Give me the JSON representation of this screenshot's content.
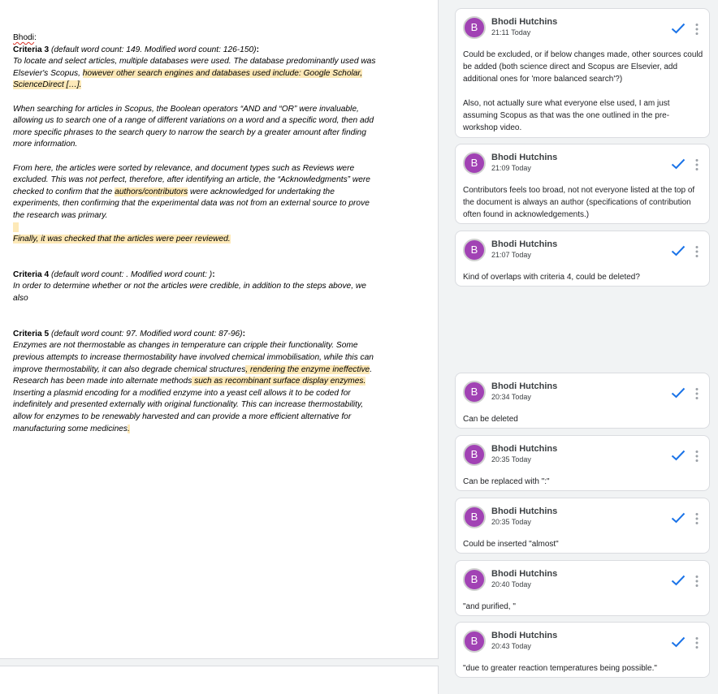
{
  "document": {
    "greeting": "Bhodi",
    "greeting_colon": ":",
    "criteria3": {
      "heading": "Criteria 3",
      "note": " (default word count: 149. Modified word count: 126-150)",
      "colon": ":",
      "p1_a": "To locate and select articles, multiple databases were used. The database predominantly used was Elsevier's Scopus, ",
      "p1_hl": "however other search engines and databases used include: Google Scholar, ScienceDirect […].",
      "p2": "When searching for articles in Scopus, the Boolean operators “AND and “OR” were invaluable, allowing us to search one of a range of different variations on a word and a specific word, then add more specific phrases to the search query to narrow the search by a greater amount after finding more information.",
      "p3_a": "From here, the articles were sorted by relevance, and document types such as Reviews were excluded. This was not perfect, therefore, after identifying an article, the “Acknowledgments” were checked to confirm that the ",
      "p3_hl": "authors/contributors",
      "p3_b": " were acknowledged for undertaking the experiments, then confirming that the experimental data was not from an external source to prove the research was primary.",
      "p4_hl": "Finally, it was checked that the articles were peer reviewed."
    },
    "criteria4": {
      "heading": "Criteria 4",
      "note": " (default word count: . Modified word count: )",
      "colon": ":",
      "p1": "In order to determine whether or not the articles were credible, in addition to the steps above, we also"
    },
    "criteria5": {
      "heading": "Criteria 5",
      "note": " (default word count: 97. Modified word count: 87-96)",
      "colon": ":",
      "p_a": "Enzymes are not thermostable as changes in temperature can cripple their functionality. Some previous attempts to increase thermostability have involved chemical immobilisation, while this can improve thermostability, it can also degrade chemical structures",
      "p_hl1": ", rendering the enzyme ineffective",
      "p_b": ". Research has been made into alternate methods",
      "p_hl2": " such as recombinant surface display enzymes.",
      "p_c": " Inserting a plasmid encoding for a modified enzyme into a yeast cell allows it to be coded for indefinitely and presented externally with",
      "p_d": " original functionality. This can increase thermostability, allow for enzymes to be renewably harvested",
      "p_e": " and can provide a more efficient alternative for manufacturing some medicines",
      "p_hl3": "."
    }
  },
  "comments": [
    {
      "avatar": "B",
      "author": "Bhodi Hutchins",
      "time": "21:11 Today",
      "body": [
        "Could be excluded, or if below changes made, other sources could be added (both science direct and Scopus are Elsevier, add additional ones for 'more balanced search'?)",
        "Also, not actually sure what everyone else used, I am just assuming Scopus as that was the one outlined in the pre-workshop video."
      ]
    },
    {
      "avatar": "B",
      "author": "Bhodi Hutchins",
      "time": "21:09 Today",
      "body": [
        "Contributors feels too broad, not not everyone listed at the top of the document is always an author (specifications of contribution often found in acknowledgements.)"
      ]
    },
    {
      "avatar": "B",
      "author": "Bhodi Hutchins",
      "time": "21:07 Today",
      "body": [
        "Kind of overlaps with criteria 4, could be deleted?"
      ]
    },
    {
      "avatar": "B",
      "author": "Bhodi Hutchins",
      "time": "20:34 Today",
      "body": [
        "Can be deleted"
      ]
    },
    {
      "avatar": "B",
      "author": "Bhodi Hutchins",
      "time": "20:35 Today",
      "body": [
        "Can be replaced with \":\""
      ]
    },
    {
      "avatar": "B",
      "author": "Bhodi Hutchins",
      "time": "20:35 Today",
      "body": [
        "Could be inserted \"almost\""
      ]
    },
    {
      "avatar": "B",
      "author": "Bhodi Hutchins",
      "time": "20:40 Today",
      "body": [
        "\"and purified, \""
      ]
    },
    {
      "avatar": "B",
      "author": "Bhodi Hutchins",
      "time": "20:43 Today",
      "body": [
        "\"due to greater reaction temperatures being possible.\""
      ]
    }
  ],
  "colors": {
    "highlight": "#fde9b8",
    "avatar": "#a142b4",
    "resolve_check": "#1a73e8",
    "panel_bg": "#f1f3f4"
  },
  "icons": {
    "resolve": "checkmark-icon",
    "more": "more-vert-icon"
  }
}
